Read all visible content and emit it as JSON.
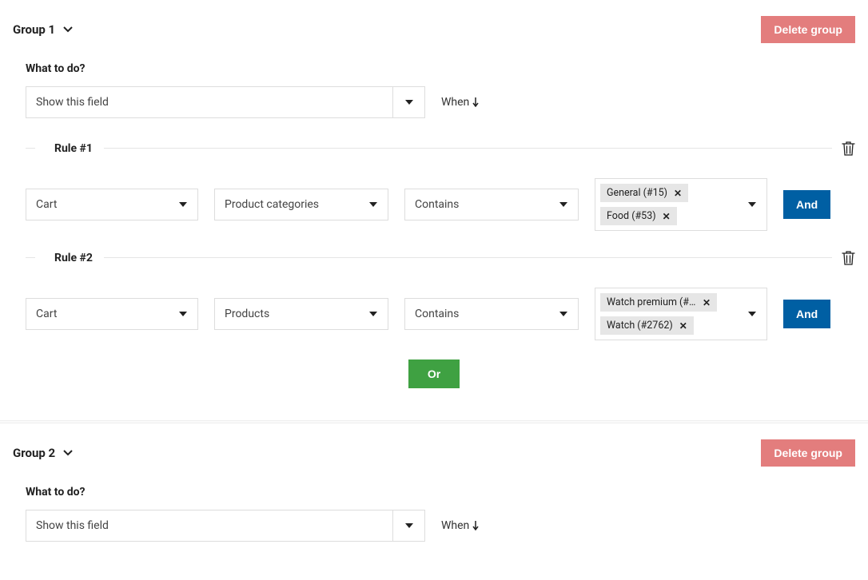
{
  "labels": {
    "delete_group": "Delete group",
    "and": "And",
    "or": "Or",
    "what_to_do": "What to do?",
    "when": "When"
  },
  "groups": [
    {
      "title": "Group 1",
      "action": "Show this field",
      "rules": [
        {
          "title": "Rule #1",
          "scope": "Cart",
          "field": "Product categories",
          "operator": "Contains",
          "tags": [
            {
              "text": "General (#15)"
            },
            {
              "text": "Food (#53)"
            }
          ]
        },
        {
          "title": "Rule #2",
          "scope": "Cart",
          "field": "Products",
          "operator": "Contains",
          "tags": [
            {
              "text": "Watch premium (#..."
            },
            {
              "text": "Watch (#2762)"
            }
          ]
        }
      ]
    },
    {
      "title": "Group 2",
      "action": "Show this field"
    }
  ]
}
